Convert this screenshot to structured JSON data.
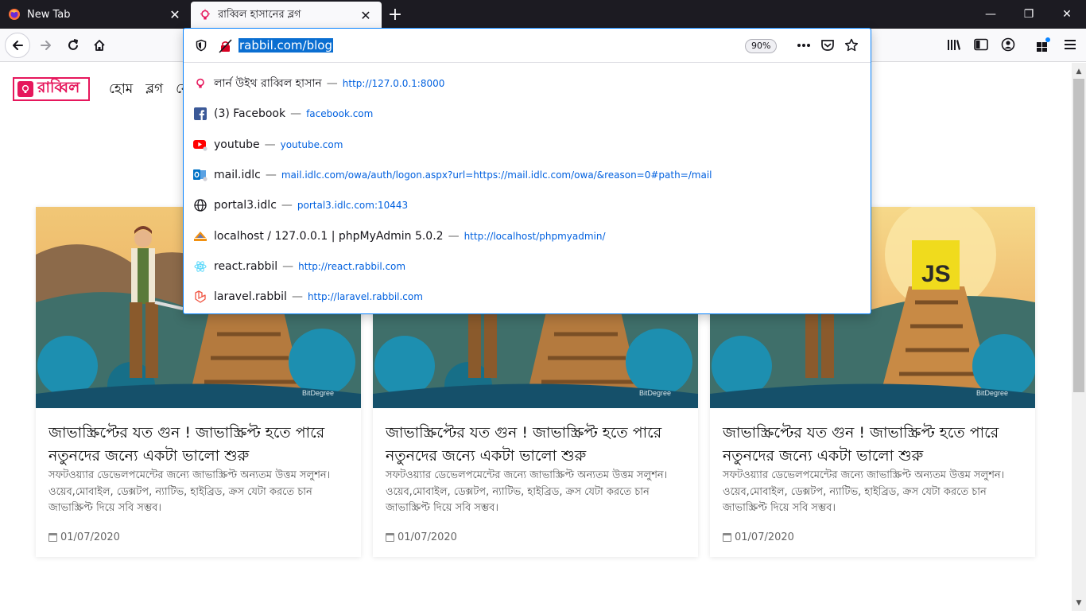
{
  "tabs": [
    {
      "title": "New Tab",
      "icon": "firefox-icon",
      "close": "✕"
    },
    {
      "title": "রাব্বিল হাসানের ব্লগ",
      "icon": "bulb-icon",
      "close": "✕"
    }
  ],
  "window_controls": {
    "minimize": "—",
    "restore": "❐",
    "close": "✕",
    "new_tab": "+"
  },
  "urlbar": {
    "text": "rabbil.com/blog",
    "zoom": "90%",
    "actions": [
      "page-actions-icon",
      "pocket-icon",
      "bookmark-star-icon"
    ]
  },
  "suggestions": [
    {
      "title": "লার্ন উইথ রাব্বিল হাসান",
      "sep": "—",
      "url": "http://127.0.0.1:8000",
      "icon": "bulb-icon"
    },
    {
      "title": "(3) Facebook",
      "sep": "—",
      "url": "facebook.com",
      "icon": "facebook-icon"
    },
    {
      "title": "youtube",
      "sep": "—",
      "url": "youtube.com",
      "icon": "youtube-icon"
    },
    {
      "title": "mail.idlc",
      "sep": "—",
      "url": "mail.idlc.com/owa/auth/logon.aspx?url=https://mail.idlc.com/owa/&reason=0#path=/mail",
      "icon": "outlook-icon"
    },
    {
      "title": "portal3.idlc",
      "sep": "—",
      "url": "portal3.idlc.com:10443",
      "icon": "globe-icon"
    },
    {
      "title": "localhost / 127.0.0.1 | phpMyAdmin 5.0.2",
      "sep": "—",
      "url": "http://localhost/phpmyadmin/",
      "icon": "phpmyadmin-icon"
    },
    {
      "title": "react.rabbil",
      "sep": "—",
      "url": "http://react.rabbil.com",
      "icon": "react-icon"
    },
    {
      "title": "laravel.rabbil",
      "sep": "—",
      "url": "http://laravel.rabbil.com",
      "icon": "laravel-icon"
    }
  ],
  "site": {
    "brand": "রাব্বিল",
    "menu": [
      "হোম",
      "ব্লগ",
      "বে"
    ]
  },
  "cards": [
    {
      "title": "জাভাস্ক্রিপ্টের যত গুন ! জাভাস্ক্রিপ্ট হতে পারে নতুনদের জন্যে একটা ভালো শুরু",
      "desc": "সফটওয়্যার ডেভেলপমেন্টের জন্যে জাভাস্ক্রিপ্ট অন্যতম উত্তম সলুশন। ওয়েব,মোবাইল, ডেক্সটপ, ন্যাটিভ, হাইব্রিড, ক্রস যেটা করতে চান জাভাস্ক্রিপ্ট দিয়ে সবি সম্ভব।",
      "date": "01/07/2020",
      "watermark": "BitDegree"
    },
    {
      "title": "জাভাস্ক্রিপ্টের যত গুন ! জাভাস্ক্রিপ্ট হতে পারে নতুনদের জন্যে একটা ভালো শুরু",
      "desc": "সফটওয়্যার ডেভেলপমেন্টের জন্যে জাভাস্ক্রিপ্ট অন্যতম উত্তম সলুশন। ওয়েব,মোবাইল, ডেক্সটপ, ন্যাটিভ, হাইব্রিড, ক্রস যেটা করতে চান জাভাস্ক্রিপ্ট দিয়ে সবি সম্ভব।",
      "date": "01/07/2020",
      "watermark": "BitDegree"
    },
    {
      "title": "জাভাস্ক্রিপ্টের যত গুন ! জাভাস্ক্রিপ্ট হতে পারে নতুনদের জন্যে একটা ভালো শুরু",
      "desc": "সফটওয়্যার ডেভেলপমেন্টের জন্যে জাভাস্ক্রিপ্ট অন্যতম উত্তম সলুশন। ওয়েব,মোবাইল, ডেক্সটপ, ন্যাটিভ, হাইব্রিড, ক্রস যেটা করতে চান জাভাস্ক্রিপ্ট দিয়ে সবি সম্ভব।",
      "date": "01/07/2020",
      "watermark": "BitDegree",
      "badge": "JS"
    }
  ],
  "colors": {
    "brand": "#e6175c",
    "link": "#0060df",
    "selection": "#0a6ed1",
    "tabstrip": "#1c1b22"
  }
}
